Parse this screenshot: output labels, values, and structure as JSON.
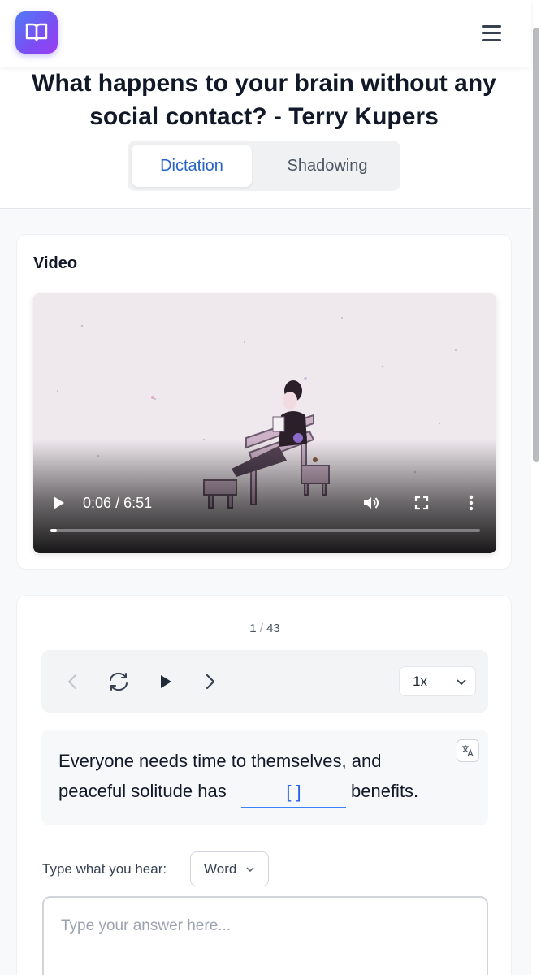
{
  "header": {
    "logo_icon": "book-icon",
    "menu_icon": "hamburger-menu-icon",
    "brand_color": "#6a55f2"
  },
  "lesson": {
    "title": "What happens to your brain without any social contact? - Terry Kupers",
    "tabs": [
      {
        "label": "Dictation",
        "active": true
      },
      {
        "label": "Shadowing",
        "active": false
      }
    ]
  },
  "video": {
    "heading": "Video",
    "current_time": "0:06",
    "separator": "/",
    "duration": "6:51",
    "progress": 0.015,
    "icons": [
      "play-icon",
      "volume-icon",
      "fullscreen-icon",
      "more-options-icon"
    ]
  },
  "practice": {
    "counter_current": "1",
    "counter_separator": "/",
    "counter_total": "43",
    "controls": [
      "previous-icon",
      "replay-icon",
      "play-icon",
      "next-icon"
    ],
    "speed": "1x",
    "sentence": {
      "line1": "Everyone needs time to themselves, and",
      "line2_before": "peaceful solitude has",
      "blank": "[ ]",
      "line2_after": "benefits."
    },
    "translate_icon": "translate-icon",
    "type_label": "Type what you hear:",
    "input_mode": "Word",
    "answer_placeholder": "Type your answer here...",
    "accent_color": "#3b82f6"
  }
}
